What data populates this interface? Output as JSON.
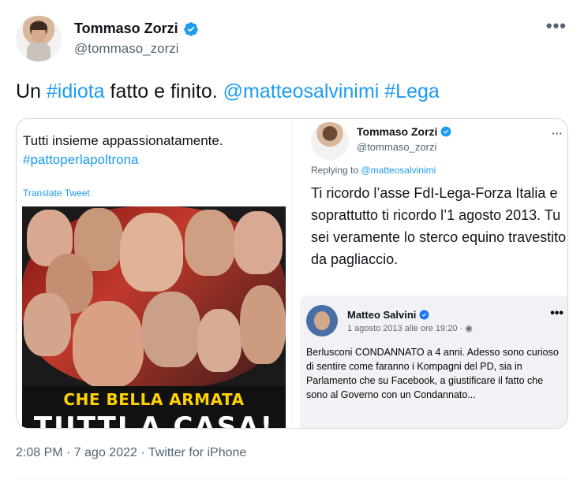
{
  "author": {
    "name": "Tommaso Zorzi",
    "handle": "@tommaso_zorzi"
  },
  "tweet": {
    "text_parts": [
      {
        "text": "Un ",
        "tag": false
      },
      {
        "text": "#idiota",
        "tag": true
      },
      {
        "text": " fatto e finito. ",
        "tag": false
      },
      {
        "text": "@matteosalvinimi",
        "tag": true
      },
      {
        "text": " ",
        "tag": false
      },
      {
        "text": "#Lega",
        "tag": true
      }
    ]
  },
  "quoted": {
    "left": {
      "line1": "Tutti insieme appassionatamente.",
      "line2": "#pattoperlapoltrona",
      "translate": "Translate Tweet",
      "banner_top": "CHE BELLA ARMATA SINISTRATA 🤣",
      "banner_bottom": "TUTTI A CASA!"
    },
    "right": {
      "name": "Tommaso Zorzi",
      "handle": "@tommaso_zorzi",
      "replying_prefix": "Replying to",
      "replying_to": "@matteosalvinimi",
      "body": "Ti ricordo l’asse FdI-Lega-Forza Italia e soprattutto ti ricordo l’1 agosto 2013. Tu sei veramente lo sterco equino travestito da pagliaccio.",
      "fb": {
        "name": "Matteo Salvini",
        "date": "1 agosto 2013 alle ore 19:20 · ◉",
        "text": "Berlusconi CONDANNATO a 4 anni. Adesso sono curioso di sentire come faranno i Kompagni del PD, sia in Parlamento che su Facebook, a giustificare il fatto che sono al Governo con un Condannato..."
      }
    }
  },
  "footer": {
    "meta": "2:08 PM · 7 ago 2022 · Twitter for iPhone"
  },
  "colors": {
    "link": "#1d9bf0",
    "secondary": "#536471",
    "verified": "#1d9bf0"
  }
}
